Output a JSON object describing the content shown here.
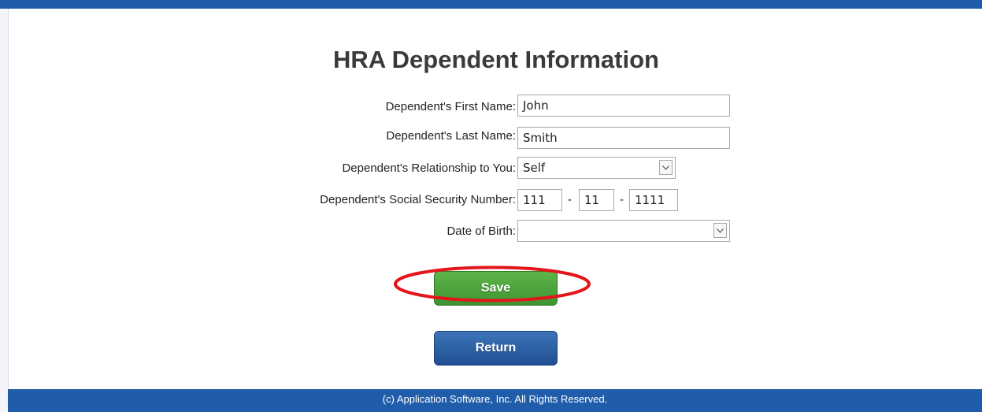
{
  "page": {
    "title": "HRA Dependent Information"
  },
  "form": {
    "first_name": {
      "label": "Dependent's First Name:",
      "value": "John"
    },
    "last_name": {
      "label": "Dependent's Last Name:",
      "value": "Smith"
    },
    "relationship": {
      "label": "Dependent's Relationship to You:",
      "value": "Self"
    },
    "ssn": {
      "label": "Dependent's Social Security Number:",
      "part1": "111",
      "part2": "11",
      "part3": "1111",
      "separator": "-"
    },
    "dob": {
      "label": "Date of Birth:",
      "value": ""
    }
  },
  "buttons": {
    "save": "Save",
    "return": "Return"
  },
  "footer": {
    "text": "(c) Application Software, Inc.  All Rights Reserved."
  },
  "colors": {
    "brand_blue": "#1f5ca9",
    "save_green": "#4aa33a",
    "annotation_red": "#e3161b"
  },
  "icons": {
    "dropdown": "chevron-down-icon"
  }
}
